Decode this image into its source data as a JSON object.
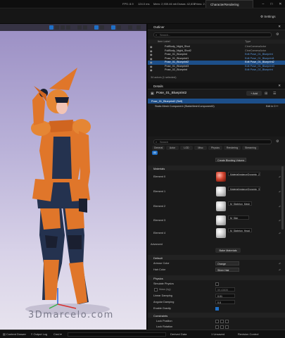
{
  "topbar": {
    "fps": "FPS: 8.9",
    "frame_ms": "124.0 ms",
    "mem": "Mem: 2,939.46 mb",
    "draws": "Draws: 42,831",
    "prims": "Prims: 2.3M",
    "project_title": "CharacterRendering"
  },
  "toolbar": {
    "settings_label": "Settings"
  },
  "watermark": "3Dmarcelo.com",
  "outliner": {
    "title": "Outliner",
    "search_placeholder": "Search...",
    "col_label": "Item Label",
    "col_type": "Type",
    "rows": [
      {
        "label": "FullBody_Night_Shot",
        "type": "CineCameraActor"
      },
      {
        "label": "FullBody_Night_Shot2",
        "type": "CineCameraActor"
      },
      {
        "label": "Pose_01_Blueprint",
        "type": "Edit Pose_01_Blueprint"
      },
      {
        "label": "Pose_01_Blueprint1",
        "type": "Edit Pose_01_Blueprint1"
      },
      {
        "label": "Pose_01_Blueprint2",
        "type": "Edit Pose_01_Blueprint2"
      },
      {
        "label": "Pose_01_Blueprint3",
        "type": "Edit Pose_01_Blueprint3"
      },
      {
        "label": "Pose_02_Blueprint",
        "type": "Edit Pose_02_Blueprint"
      }
    ],
    "footer": "34 actors (1 selected)"
  },
  "details": {
    "title": "Details",
    "actor_name": "Pose_01_Blueprint2",
    "add_label": "+ Add",
    "component_root": "Pose_01_Blueprint2 (Self)",
    "component_child": "Static Mesh Component (StaticMeshComponent0)",
    "edit_in_cpp": "Edit in C++",
    "search_placeholder": "Search",
    "tabs": [
      "General",
      "Actor",
      "LOD",
      "Misc",
      "Physics",
      "Rendering",
      "Streaming",
      "All"
    ],
    "create_blocking_volume": "Create Blocking Volume",
    "materials_header": "Materials",
    "elements": [
      {
        "label": "Element 0",
        "material": "MaterialInstanceDynamic_2"
      },
      {
        "label": "Element 1",
        "material": "MaterialInstanceDynamic_3"
      },
      {
        "label": "Element 2",
        "material": "M_Skeleton_Mesh"
      },
      {
        "label": "Element 3",
        "material": "M_Skin"
      },
      {
        "label": "Element 4",
        "material": "M_Skeleton_Head"
      }
    ],
    "advanced": "Advanced",
    "bake_materials": "Bake Materials",
    "default_header": "Default",
    "armour_color_label": "Armour Color",
    "armour_color_value": "Orange",
    "hair_color_label": "Hair Color",
    "hair_color_value": "Silver Hair",
    "physics_header": "Physics",
    "simulate_physics": "Simulate Physics",
    "mass_kg": "Mass (kg)",
    "mass_value": "59.43835",
    "linear_damping": "Linear Damping",
    "linear_damping_value": "0.01",
    "angular_damping": "Angular Damping",
    "angular_damping_value": "0.0",
    "enable_gravity": "Enable Gravity",
    "constraints_header": "Constraints",
    "lock_position": "Lock Position",
    "lock_rotation": "Lock Rotation"
  },
  "statusbar": {
    "content_drawer": "Content Drawer",
    "output_log": "Output Log",
    "cmd": "Cmd",
    "derived_data": "Derived Data",
    "unsaved": "1 Unsaved",
    "revision_control": "Revision Control"
  },
  "colors": {
    "accent": "#1f6fc6",
    "selection": "#1d4f8a",
    "armour_orange": "#e0762a",
    "suit_navy": "#24324f"
  }
}
